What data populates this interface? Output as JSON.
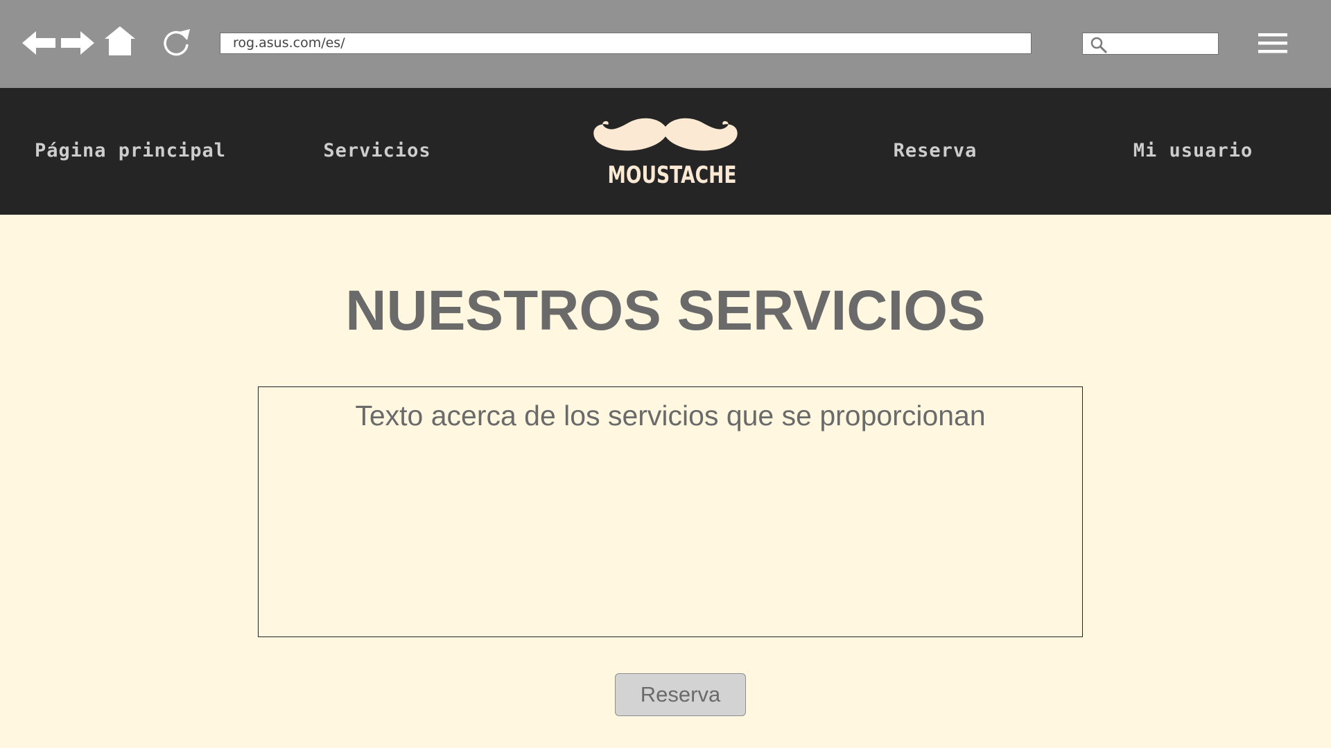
{
  "browser": {
    "url": "rog.asus.com/es/",
    "icons": [
      "back-arrow-icon",
      "forward-arrow-icon",
      "home-icon",
      "refresh-icon",
      "search-icon",
      "hamburger-menu-icon"
    ]
  },
  "nav": {
    "home": "Página principal",
    "services": "Servicios",
    "reserve": "Reserva",
    "user": "Mi usuario"
  },
  "logo": {
    "text": "MOUSTACHE"
  },
  "main": {
    "title": "NUESTROS SERVICIOS",
    "content_text": "Texto acerca de los servicios que se proporcionan",
    "button_label": "Reserva"
  },
  "colors": {
    "chrome_bg": "#929292",
    "nav_bg": "#252525",
    "page_bg": "#fff7e0",
    "logo_color": "#fbe9d4",
    "text_gray": "#6a6a6a"
  }
}
